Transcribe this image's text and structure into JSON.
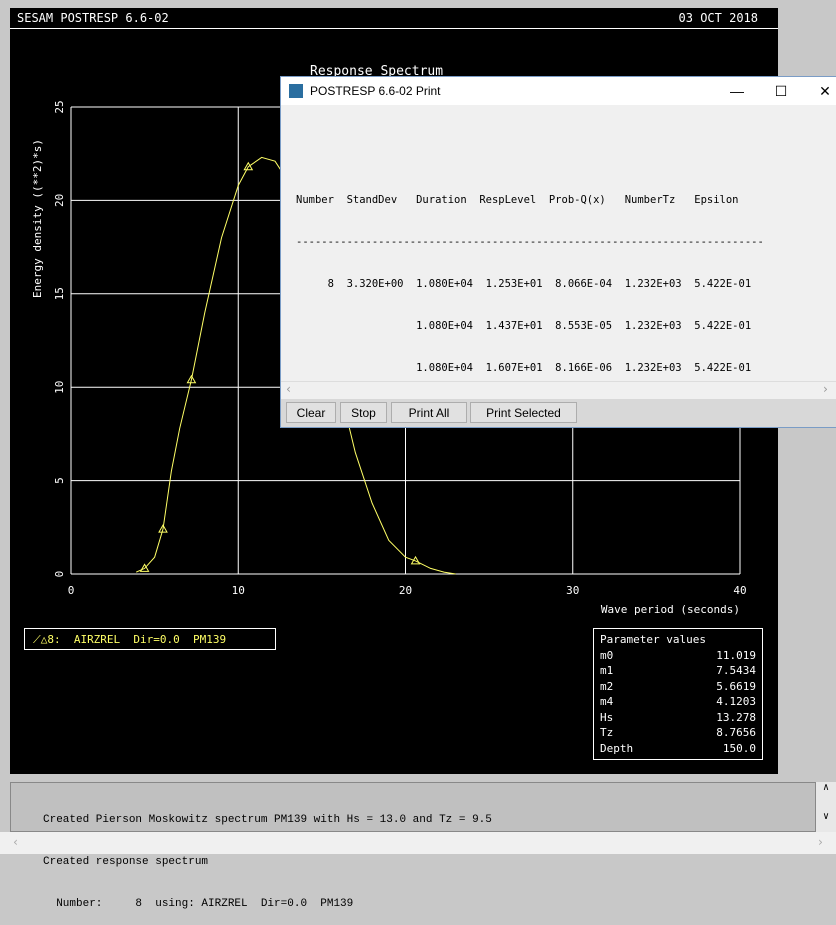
{
  "header": {
    "title": "SESAM POSTRESP 6.6-02",
    "date": "03 OCT 2018"
  },
  "chart_data": {
    "type": "line",
    "title": "Response Spectrum",
    "xlabel": "Wave period (seconds)",
    "ylabel": "Energy density ((**2)*s)",
    "xlim": [
      0,
      40
    ],
    "ylim": [
      0,
      25
    ],
    "xticks": [
      "0",
      "10",
      "20",
      "30",
      "40"
    ],
    "yticks": [
      "0",
      "5",
      "10",
      "15",
      "20",
      "25"
    ],
    "grid": true,
    "series": [
      {
        "name": "8:  AIRZREL  Dir=0.0  PM139",
        "color": "#ffff66",
        "x": [
          3.9,
          4.4,
          5.0,
          5.5,
          6.0,
          6.5,
          7.2,
          8.0,
          9.0,
          10.0,
          10.6,
          11.4,
          12.2,
          13.0,
          14.0,
          15.0,
          16.0,
          17.0,
          18.0,
          19.0,
          20.0,
          20.6,
          21.5,
          22.3,
          23.0
        ],
        "y": [
          0.1,
          0.3,
          0.9,
          2.4,
          5.5,
          7.8,
          10.4,
          14.0,
          18.0,
          20.8,
          21.8,
          22.3,
          22.1,
          21.0,
          18.0,
          14.0,
          10.2,
          6.5,
          3.8,
          1.8,
          0.9,
          0.7,
          0.3,
          0.1,
          0.0
        ],
        "markers_x": [
          4.4,
          5.5,
          7.2,
          10.6,
          20.6
        ]
      }
    ]
  },
  "legend": {
    "label": "8:  AIRZREL  Dir=0.0  PM139"
  },
  "params": {
    "title": "Parameter values",
    "rows": [
      {
        "k": "m0",
        "v": "11.019"
      },
      {
        "k": "m1",
        "v": "7.5434"
      },
      {
        "k": "m2",
        "v": "5.6619"
      },
      {
        "k": "m4",
        "v": "4.1203"
      },
      {
        "k": "Hs",
        "v": "13.278"
      },
      {
        "k": "Tz",
        "v": "8.7656"
      },
      {
        "k": "Depth",
        "v": "150.0"
      }
    ]
  },
  "dialog": {
    "title": "POSTRESP  6.6-02   Print",
    "minimize": "—",
    "maximize": "☐",
    "close": "✕",
    "lines": [
      "Number  StandDev   Duration  RespLevel  Prob-Q(x)   NumberTz   Epsilon",
      "--------------------------------------------------------------------------",
      "     8  3.320E+00  1.080E+04  1.253E+01  8.066E-04  1.232E+03  5.422E-01",
      "                   1.080E+04  1.437E+01  8.553E-05  1.232E+03  5.422E-01",
      "                   1.080E+04  1.607E+01  8.166E-06  1.232E+03  5.422E-01"
    ],
    "buttons": {
      "clear": "Clear",
      "stop": "Stop",
      "print_all": "Print All",
      "print_selected": "Print Selected"
    }
  },
  "console": {
    "lines": [
      "Created Pierson Moskowitz spectrum PM139 with Hs = 13.0 and Tz = 9.5",
      "Created response spectrum",
      "  Number:     8  using: AIRZREL  Dir=0.0  PM139"
    ]
  }
}
